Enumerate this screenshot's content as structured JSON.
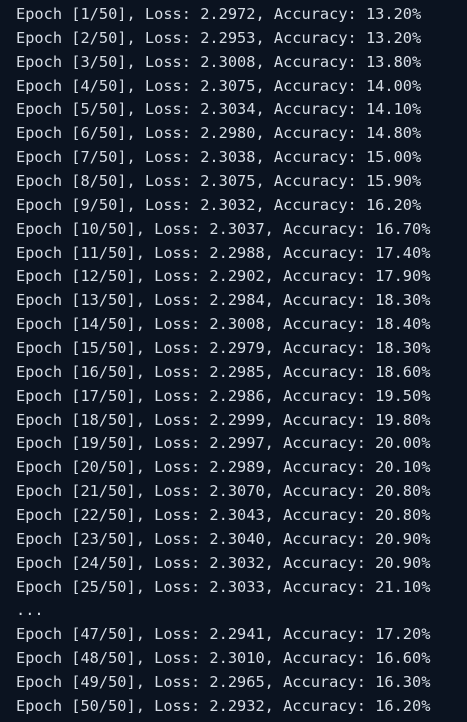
{
  "terminal": {
    "lines": [
      "Epoch [1/50], Loss: 2.2972, Accuracy: 13.20%",
      "Epoch [2/50], Loss: 2.2953, Accuracy: 13.20%",
      "Epoch [3/50], Loss: 2.3008, Accuracy: 13.80%",
      "Epoch [4/50], Loss: 2.3075, Accuracy: 14.00%",
      "Epoch [5/50], Loss: 2.3034, Accuracy: 14.10%",
      "Epoch [6/50], Loss: 2.2980, Accuracy: 14.80%",
      "Epoch [7/50], Loss: 2.3038, Accuracy: 15.00%",
      "Epoch [8/50], Loss: 2.3075, Accuracy: 15.90%",
      "Epoch [9/50], Loss: 2.3032, Accuracy: 16.20%",
      "Epoch [10/50], Loss: 2.3037, Accuracy: 16.70%",
      "Epoch [11/50], Loss: 2.2988, Accuracy: 17.40%",
      "Epoch [12/50], Loss: 2.2902, Accuracy: 17.90%",
      "Epoch [13/50], Loss: 2.2984, Accuracy: 18.30%",
      "Epoch [14/50], Loss: 2.3008, Accuracy: 18.40%",
      "Epoch [15/50], Loss: 2.2979, Accuracy: 18.30%",
      "Epoch [16/50], Loss: 2.2985, Accuracy: 18.60%",
      "Epoch [17/50], Loss: 2.2986, Accuracy: 19.50%",
      "Epoch [18/50], Loss: 2.2999, Accuracy: 19.80%",
      "Epoch [19/50], Loss: 2.2997, Accuracy: 20.00%",
      "Epoch [20/50], Loss: 2.2989, Accuracy: 20.10%",
      "Epoch [21/50], Loss: 2.3070, Accuracy: 20.80%",
      "Epoch [22/50], Loss: 2.3043, Accuracy: 20.80%",
      "Epoch [23/50], Loss: 2.3040, Accuracy: 20.90%",
      "Epoch [24/50], Loss: 2.3032, Accuracy: 20.90%",
      "Epoch [25/50], Loss: 2.3033, Accuracy: 21.10%",
      "...",
      "Epoch [47/50], Loss: 2.2941, Accuracy: 17.20%",
      "Epoch [48/50], Loss: 2.3010, Accuracy: 16.60%",
      "Epoch [49/50], Loss: 2.2965, Accuracy: 16.30%",
      "Epoch [50/50], Loss: 2.2932, Accuracy: 16.20%"
    ]
  },
  "colors": {
    "background": "#0b1320",
    "text": "#d6dde6"
  }
}
